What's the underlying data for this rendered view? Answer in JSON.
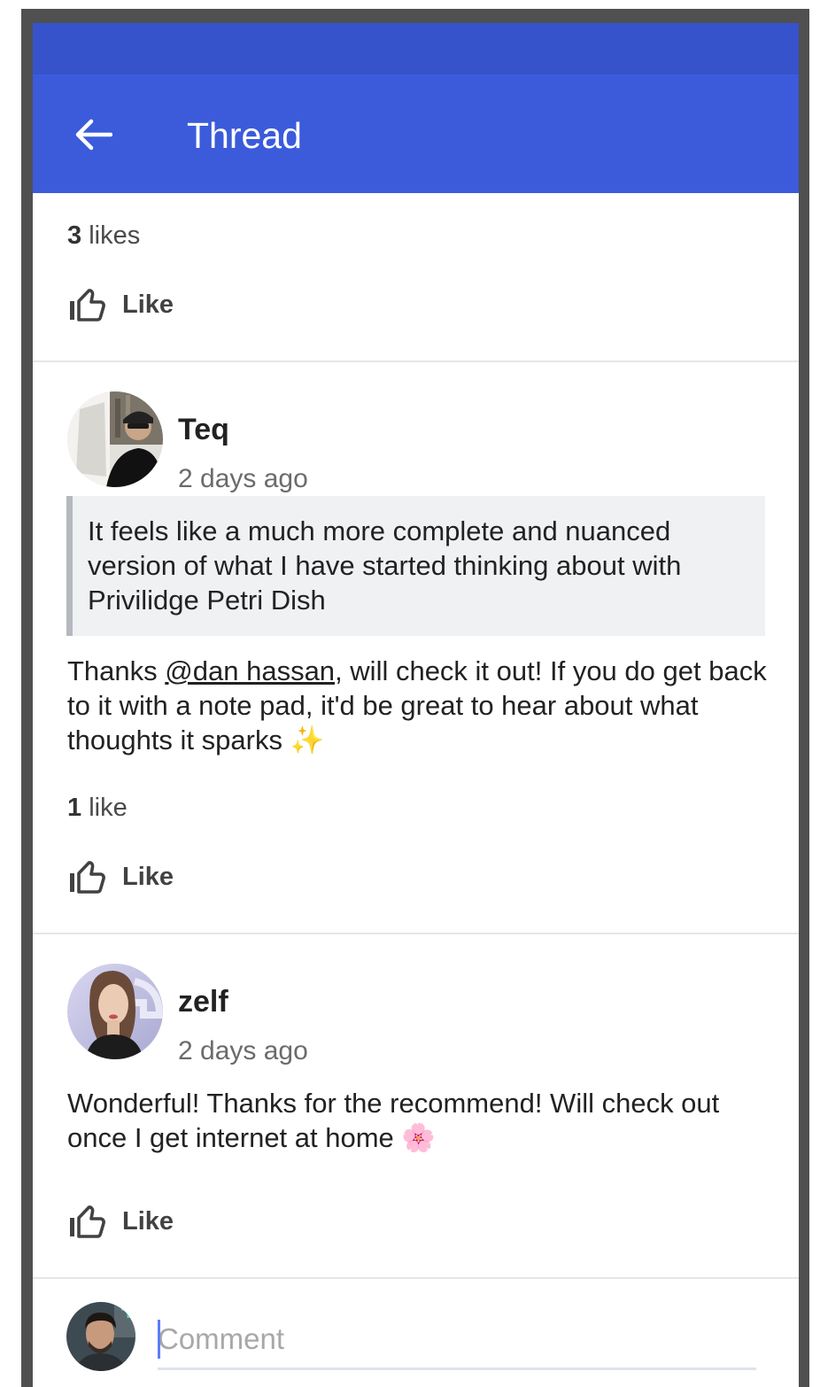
{
  "appbar": {
    "title": "Thread",
    "back_icon": "arrow-left-icon",
    "color": "#3b5bdb",
    "statusbar_color": "#3653cc"
  },
  "top_post": {
    "likes_count": "3",
    "likes_label": " likes",
    "like_button": "Like"
  },
  "comments": [
    {
      "author": "Teq",
      "time": "2 days ago",
      "quote": "It feels like a much more complete and nuanced version of what I have started thinking about with Privilidge Petri Dish",
      "text_before": "Thanks ",
      "mention": "@dan hassan",
      "text_after": ", will check it out! If you do get back to it with a note pad, it'd be great to hear about what thoughts it sparks ✨",
      "likes_count": "1",
      "likes_label": " like",
      "like_button": "Like"
    },
    {
      "author": "zelf",
      "time": "2 days ago",
      "text": "Wonderful! Thanks for the recommend! Will check out once I get internet at home 🌸",
      "like_button": "Like"
    }
  ],
  "composer": {
    "placeholder": "Comment"
  }
}
